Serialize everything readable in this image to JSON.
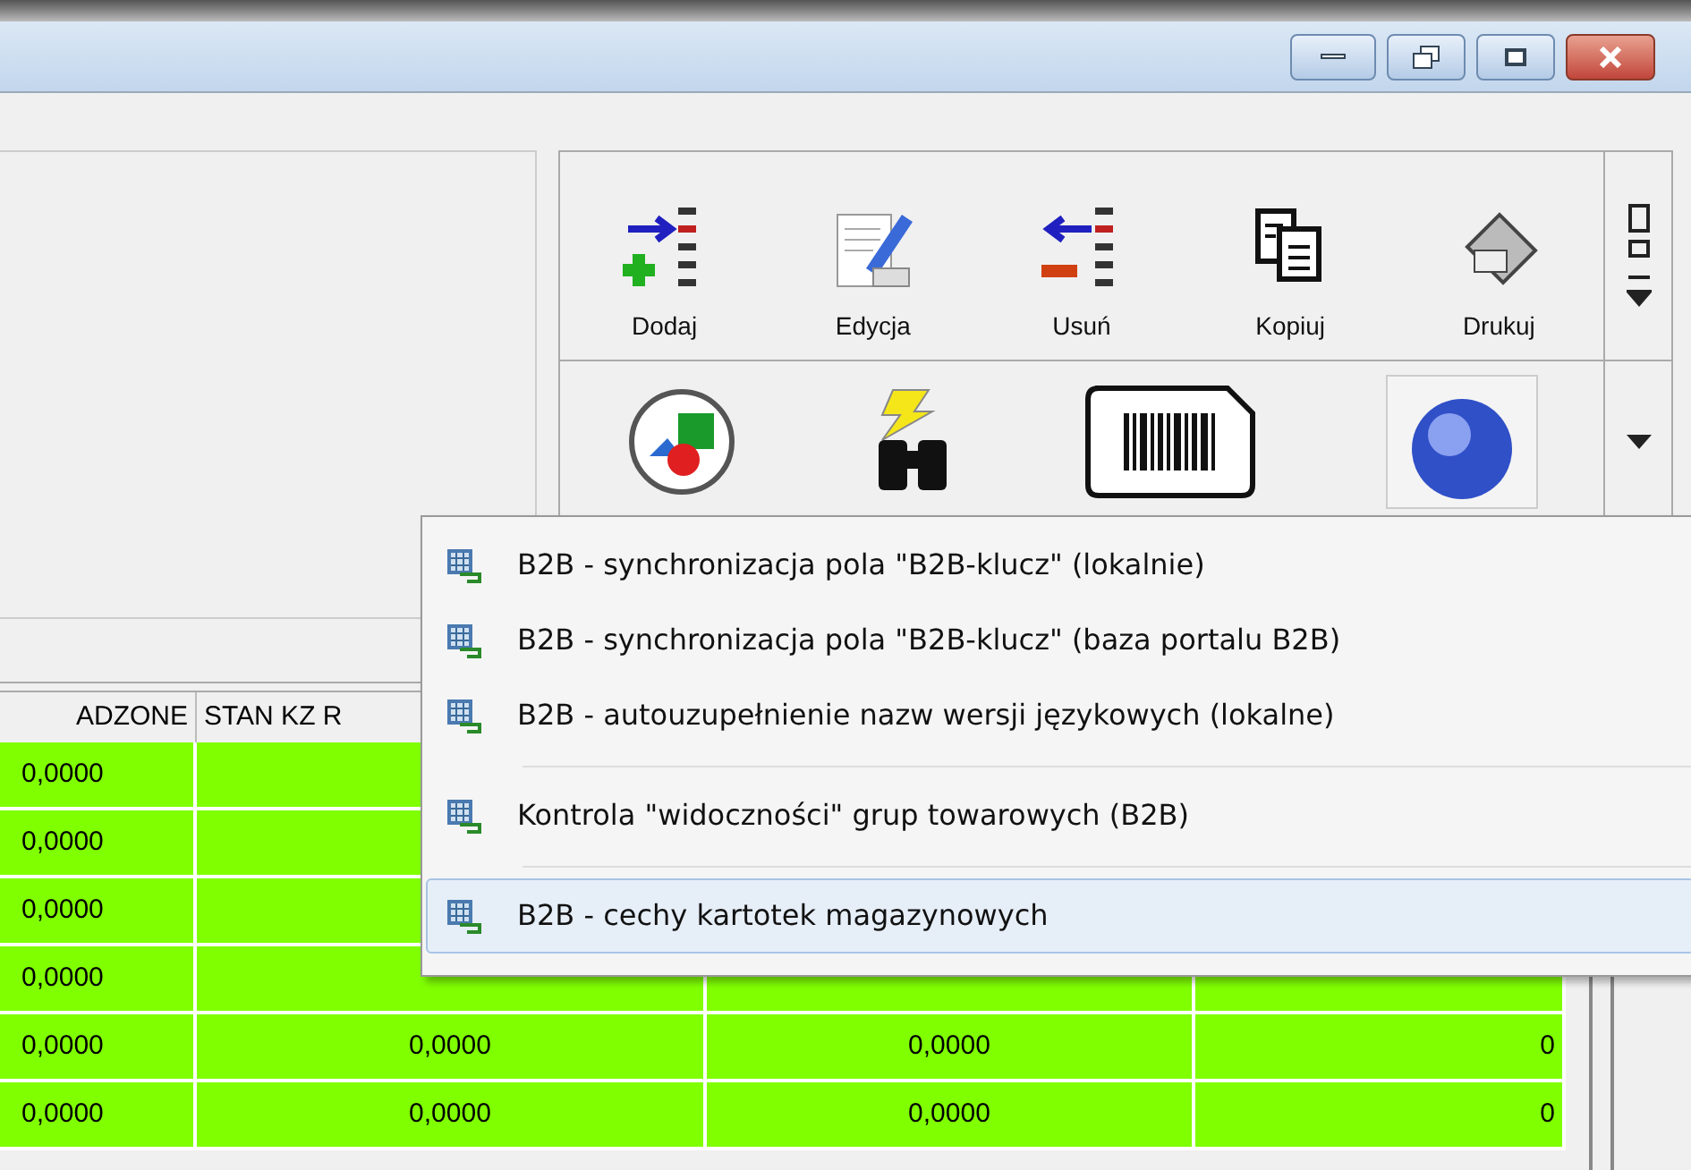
{
  "toolbar": {
    "buttons": [
      {
        "label": "Dodaj"
      },
      {
        "label": "Edycja"
      },
      {
        "label": "Usuń"
      },
      {
        "label": "Kopiuj"
      },
      {
        "label": "Drukuj"
      }
    ]
  },
  "table": {
    "columns": [
      "ADZONE",
      "STAN KZ R"
    ],
    "rows": [
      {
        "cells": [
          "0,0000",
          "",
          "",
          ""
        ]
      },
      {
        "cells": [
          "0,0000",
          "",
          "",
          ""
        ]
      },
      {
        "cells": [
          "0,0000",
          "",
          "",
          ""
        ]
      },
      {
        "cells": [
          "0,0000",
          "",
          "",
          ""
        ]
      },
      {
        "cells": [
          "0,0000",
          "0,0000",
          "0,0000",
          "0"
        ]
      },
      {
        "cells": [
          "0,0000",
          "0,0000",
          "0,0000",
          "0"
        ]
      }
    ]
  },
  "context_menu": {
    "items": [
      {
        "kind": "item",
        "label": "B2B - synchronizacja pola \"B2B-klucz\" (lokalnie)",
        "selected": false
      },
      {
        "kind": "item",
        "label": "B2B - synchronizacja pola \"B2B-klucz\" (baza portalu B2B)",
        "selected": false
      },
      {
        "kind": "item",
        "label": "B2B - autouzupełnienie nazw wersji językowych (lokalne)",
        "selected": false
      },
      {
        "kind": "separator"
      },
      {
        "kind": "item",
        "label": "Kontrola \"widoczności\" grup towarowych (B2B)",
        "selected": false
      },
      {
        "kind": "separator"
      },
      {
        "kind": "item",
        "label": "B2B - cechy kartotek magazynowych",
        "selected": true
      }
    ]
  }
}
